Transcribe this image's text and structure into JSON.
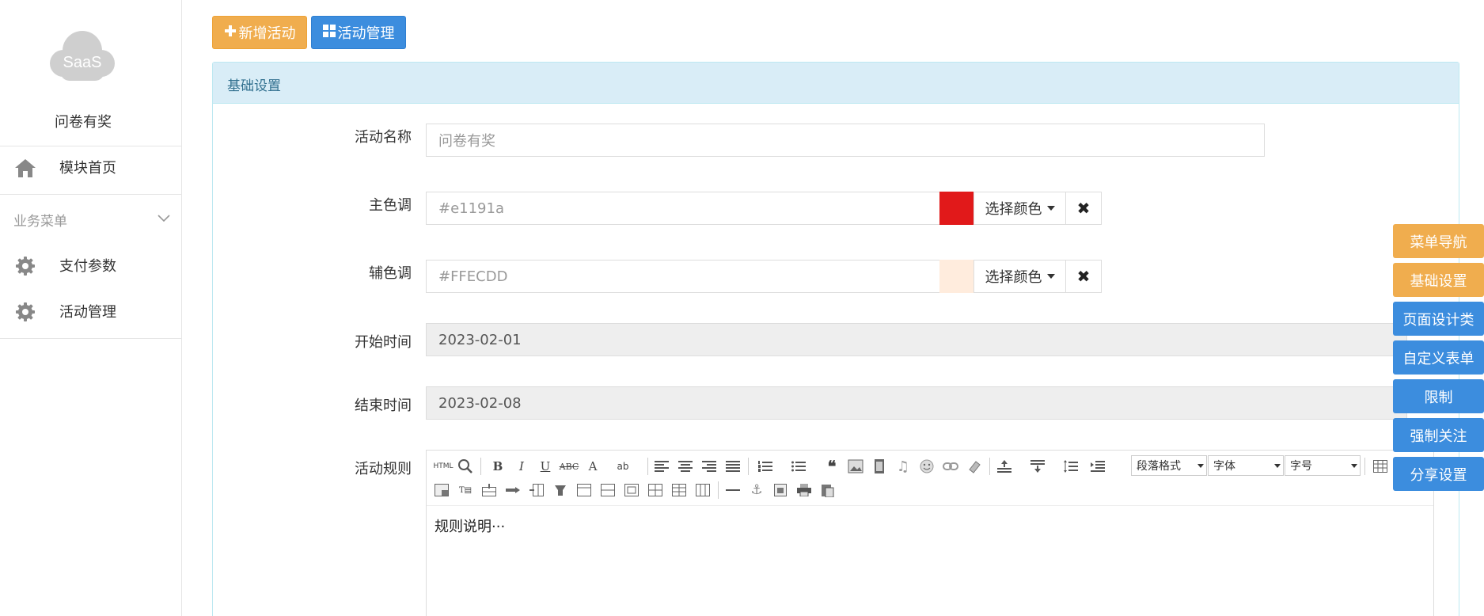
{
  "sidebar": {
    "logo_text": "SaaS",
    "app_name": "问卷有奖",
    "home_label": "模块首页",
    "group_label": "业务菜单",
    "items": [
      {
        "label": "支付参数",
        "icon": "gear-icon"
      },
      {
        "label": "活动管理",
        "icon": "gear-icon"
      }
    ]
  },
  "top_buttons": {
    "add_label": "新增活动",
    "manage_label": "活动管理"
  },
  "panel": {
    "title": "基础设置"
  },
  "form": {
    "name_label": "活动名称",
    "name_placeholder": "问卷有奖",
    "primary_label": "主色调",
    "primary_value": "#e1191a",
    "primary_color": "#e1191a",
    "secondary_label": "辅色调",
    "secondary_value": "#FFECDD",
    "secondary_color": "#FFECDD",
    "pick_color_label": "选择颜色",
    "clear_symbol": "✖",
    "start_label": "开始时间",
    "start_value": "2023-02-01",
    "end_label": "结束时间",
    "end_value": "2023-02-08",
    "rules_label": "活动规则"
  },
  "editor": {
    "html_btn": "HTML",
    "paragraph_select": "段落格式",
    "font_select": "字体",
    "size_select": "字号",
    "content": "规则说明···"
  },
  "float_nav": [
    {
      "label": "菜单导航",
      "color": "#f0ad4e"
    },
    {
      "label": "基础设置",
      "color": "#f0ad4e"
    },
    {
      "label": "页面设计类",
      "color": "#3c8dde"
    },
    {
      "label": "自定义表单",
      "color": "#3c8dde"
    },
    {
      "label": "限制",
      "color": "#3c8dde"
    },
    {
      "label": "强制关注",
      "color": "#3c8dde"
    },
    {
      "label": "分享设置",
      "color": "#3c8dde"
    }
  ]
}
